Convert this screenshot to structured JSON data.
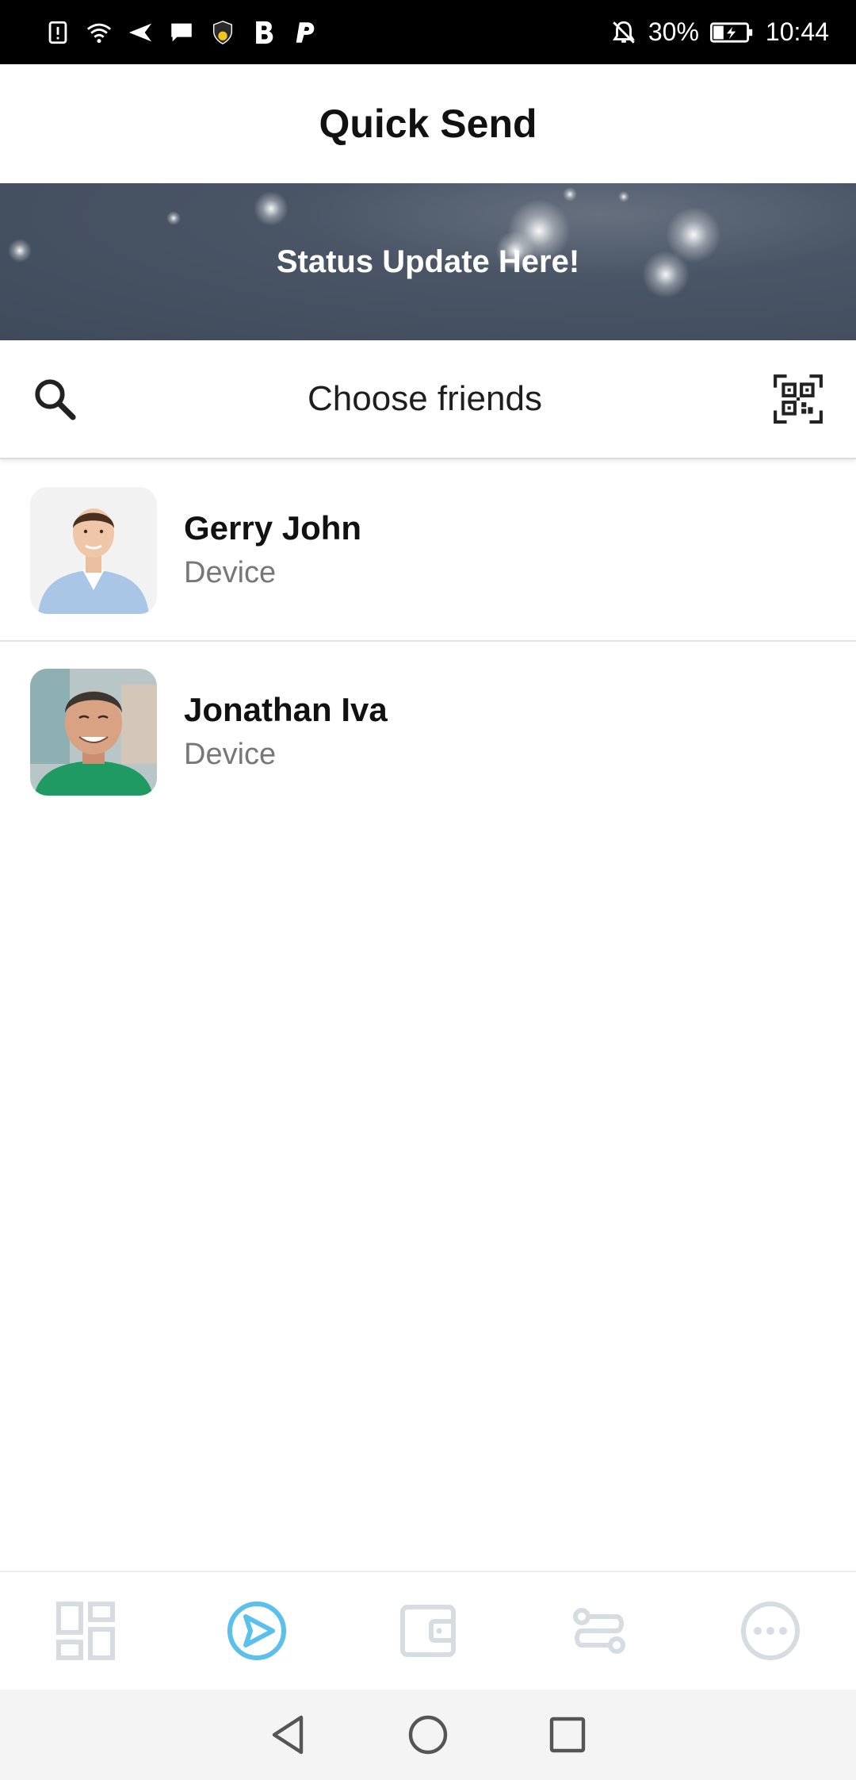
{
  "status_bar": {
    "battery": "30%",
    "time": "10:44",
    "left_icons": [
      "alert-icon",
      "wifi-icon",
      "send-icon",
      "message-icon",
      "shield-icon",
      "bold-b-icon",
      "p-icon"
    ],
    "right_icons": [
      "bell-off-icon",
      "battery-icon"
    ]
  },
  "header": {
    "title": "Quick Send"
  },
  "banner": {
    "text": "Status Update Here!"
  },
  "search": {
    "label": "Choose friends",
    "left_icon": "search-icon",
    "right_icon": "qr-code-icon"
  },
  "friends": [
    {
      "name": "Gerry John",
      "subtitle": "Device"
    },
    {
      "name": "Jonathan Iva",
      "subtitle": "Device"
    }
  ],
  "tabs": [
    {
      "icon": "dashboard-icon",
      "active": false
    },
    {
      "icon": "send-icon",
      "active": true
    },
    {
      "icon": "wallet-icon",
      "active": false
    },
    {
      "icon": "route-icon",
      "active": false
    },
    {
      "icon": "more-icon",
      "active": false
    }
  ],
  "colors": {
    "accent": "#5bc0eb",
    "inactive_tab": "#d5dde3",
    "banner_bg": "#465062",
    "status_bar_bg": "#000000"
  },
  "nav": {
    "icons": [
      "back-icon",
      "home-icon",
      "recents-icon"
    ]
  }
}
